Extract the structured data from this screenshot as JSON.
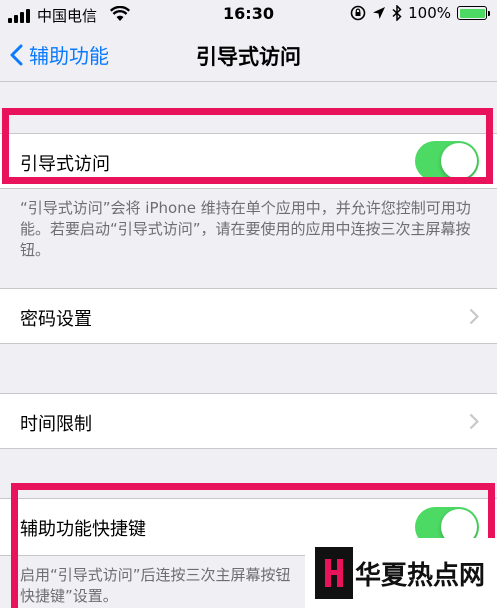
{
  "status_bar": {
    "carrier": "中国电信",
    "time": "16:30",
    "battery": "100%",
    "icons": [
      "signal-icon",
      "wifi-icon",
      "rotation-lock-icon",
      "location-icon",
      "bluetooth-icon",
      "battery-icon"
    ]
  },
  "nav": {
    "back_label": "辅助功能",
    "title": "引导式访问"
  },
  "guided_access": {
    "label": "引导式访问",
    "enabled": true,
    "footer": "“引导式访问”会将 iPhone 维持在单个应用中，并允许您控制可用功能。若要启动“引导式访问”，请在要使用的应用中连按三次主屏幕按钮。"
  },
  "passcode_settings": {
    "label": "密码设置"
  },
  "time_limits": {
    "label": "时间限制"
  },
  "accessibility_shortcut": {
    "label": "辅助功能快捷键",
    "enabled": true,
    "footer": "启用“引导式访问”后连按三次主屏幕按钮",
    "footer_line2": "快捷键”设置。"
  },
  "watermark": {
    "text": "华夏热点网"
  },
  "colors": {
    "accent": "#0a7aff",
    "switch_on": "#4cd964",
    "annotation": "#e8135b",
    "background": "#efeff4"
  }
}
